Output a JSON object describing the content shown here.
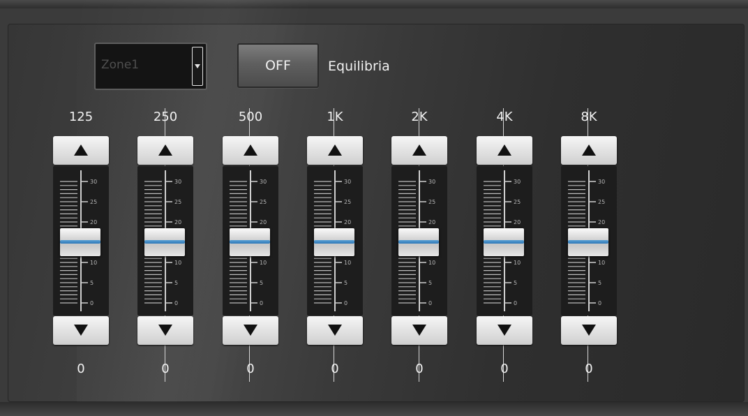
{
  "zone": {
    "value": "Zone1"
  },
  "power": {
    "label": "OFF"
  },
  "title": "Equilibria",
  "scale_labels": [
    "30",
    "25",
    "20",
    "15",
    "10",
    "5",
    "0"
  ],
  "colors": {
    "accent": "#2f78b8",
    "background": "#3b3b3b"
  },
  "bands": [
    {
      "freq": "125",
      "value": "0",
      "level": 15
    },
    {
      "freq": "250",
      "value": "0",
      "level": 15
    },
    {
      "freq": "500",
      "value": "0",
      "level": 15
    },
    {
      "freq": "1K",
      "value": "0",
      "level": 15
    },
    {
      "freq": "2K",
      "value": "0",
      "level": 15
    },
    {
      "freq": "4K",
      "value": "0",
      "level": 15
    },
    {
      "freq": "8K",
      "value": "0",
      "level": 15
    }
  ]
}
